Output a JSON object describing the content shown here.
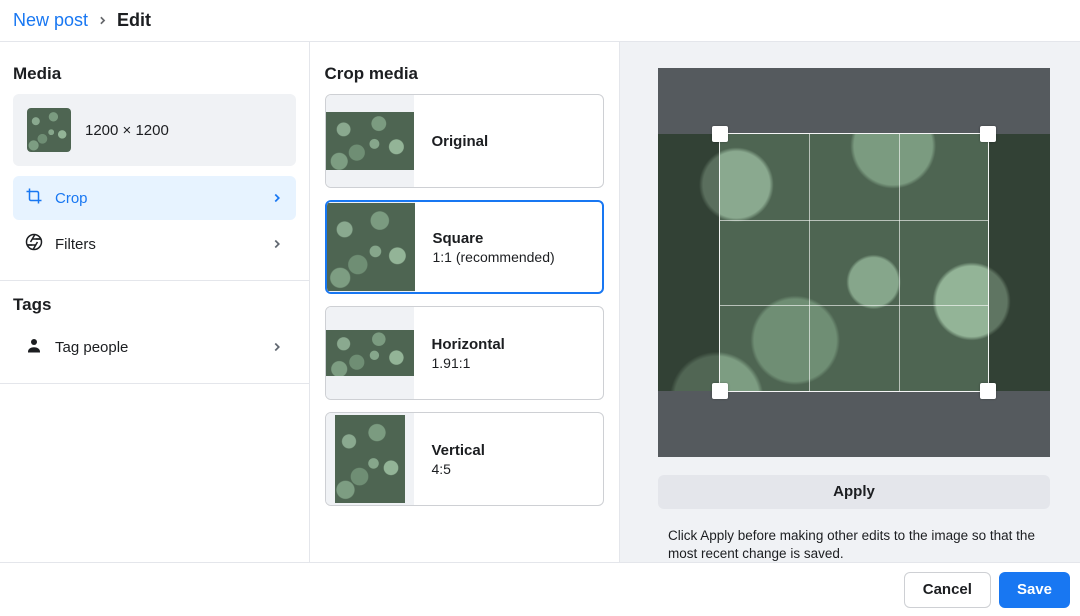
{
  "breadcrumb": {
    "back": "New post",
    "current": "Edit"
  },
  "sidebar": {
    "media_title": "Media",
    "media_dims": "1200 × 1200",
    "crop_label": "Crop",
    "filters_label": "Filters",
    "tags_title": "Tags",
    "tag_people_label": "Tag people"
  },
  "crop": {
    "title": "Crop media",
    "options": [
      {
        "label": "Original",
        "sub": ""
      },
      {
        "label": "Square",
        "sub": "1:1 (recommended)"
      },
      {
        "label": "Horizontal",
        "sub": "1.91:1"
      },
      {
        "label": "Vertical",
        "sub": "4:5"
      }
    ]
  },
  "preview": {
    "apply_label": "Apply",
    "hint": "Click Apply before making other edits to the image so that the most recent change is saved."
  },
  "footer": {
    "cancel": "Cancel",
    "save": "Save"
  }
}
